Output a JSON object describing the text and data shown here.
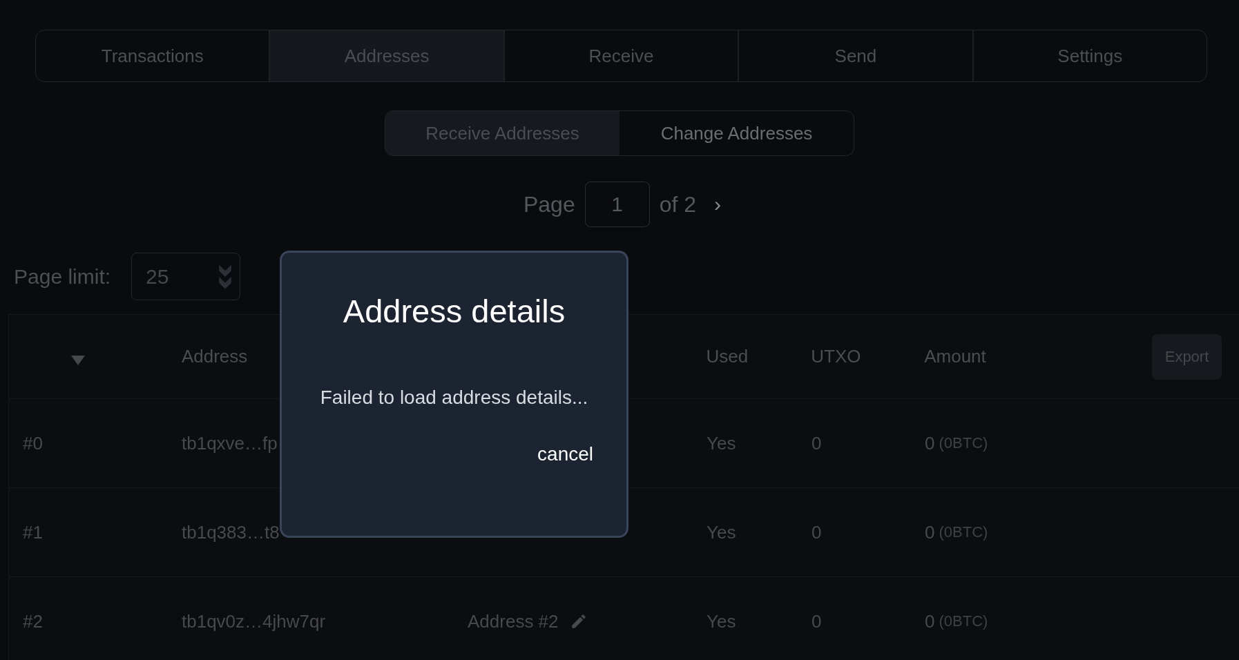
{
  "tabs": [
    {
      "label": "Transactions",
      "selected": false
    },
    {
      "label": "Addresses",
      "selected": true
    },
    {
      "label": "Receive",
      "selected": false
    },
    {
      "label": "Send",
      "selected": false
    },
    {
      "label": "Settings",
      "selected": false
    }
  ],
  "address_types": [
    {
      "label": "Receive Addresses",
      "selected": true
    },
    {
      "label": "Change Addresses",
      "selected": false
    }
  ],
  "pagination": {
    "label": "Page",
    "value": "1",
    "total": "of 2",
    "next": "›"
  },
  "page_limit": {
    "label": "Page limit:",
    "value": "25"
  },
  "table": {
    "columns": [
      "Address",
      "Used",
      "UTXO",
      "Amount"
    ],
    "export": "Export",
    "rows": [
      {
        "index": "#0",
        "address": "tb1qxve…fp",
        "used": "Yes",
        "utxo": "0",
        "amount": "0",
        "amount_btc": "(0BTC)"
      },
      {
        "index": "#1",
        "address": "tb1q383…t8",
        "used": "Yes",
        "utxo": "0",
        "amount": "0",
        "amount_btc": "(0BTC)"
      },
      {
        "index": "#2",
        "address": "tb1qv0z…4jhw7qr",
        "label": "Address #2",
        "used": "Yes",
        "utxo": "0",
        "amount": "0",
        "amount_btc": "(0BTC)"
      }
    ]
  },
  "dialog": {
    "title": "Address details",
    "message": "Failed to load address details...",
    "cancel": "cancel"
  }
}
